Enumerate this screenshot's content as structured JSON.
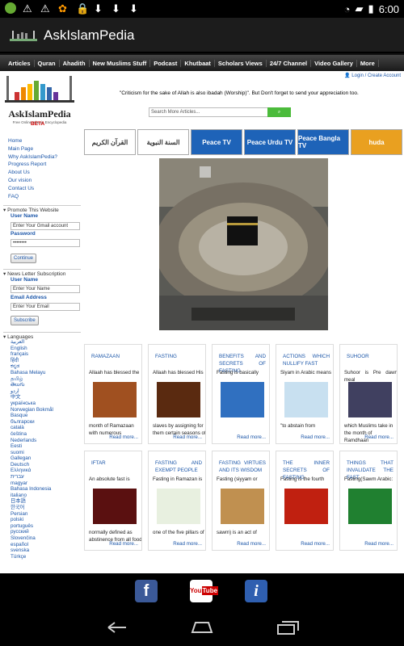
{
  "status": {
    "time": "6:00"
  },
  "app": {
    "title": "AskIslamPedia"
  },
  "nav": [
    "Articles",
    "Quran",
    "Ahadith",
    "New Muslims Stuff",
    "Podcast",
    "Khutbaat",
    "Scholars Views",
    "24/7 Channel",
    "Video Gallery",
    "More"
  ],
  "header": {
    "login": "Login",
    "separator": "/",
    "create": "Create Account",
    "quote": "\"Criticism for the sake of Allah is also ibadah (Worship)\". But Don't forget to send your appreciation too.",
    "search_placeholder": "Search More Articles...",
    "search_button": "Search"
  },
  "logo": {
    "name": "AskIslamPedia",
    "tagline": "Free Online Islamic Encyclopedia",
    "beta": "BETA"
  },
  "sidebar": {
    "links": [
      "Home",
      "Main Page",
      "Why AskIslamPedia?",
      "Progress Report",
      "About Us",
      "Our vision",
      "Contact Us",
      "FAQ"
    ],
    "promote_head": "Promote This Website",
    "promote_user_label": "User Name",
    "promote_user_value": "Enter Your Gmail account",
    "promote_pass_label": "Password",
    "promote_pass_value": "••••••••",
    "continue": "Continue",
    "newsletter_head": "News Letter Subscription",
    "news_user_label": "User Name",
    "news_user_value": "Enter Your Name",
    "news_email_label": "Email Address",
    "news_email_value": "Enter Your Email",
    "subscribe": "Subscribe",
    "languages_head": "Languages",
    "languages": [
      "العربية",
      "English",
      "français",
      "हिंदी",
      "ಕನ್ನಡ",
      "Bahasa Melayu",
      "தமிழ்",
      "తెలుగు",
      "اردو",
      "中文",
      "українська",
      "Norwegian Bokmål",
      "Basque",
      "български",
      "català",
      "čeština",
      "Nederlands",
      "Eesti",
      "suomi",
      "Gallegan",
      "Deutsch",
      "Ελληνικά",
      "עברית",
      "magyar",
      "Bahasa Indonesia",
      "italiano",
      "日本語",
      "한국어",
      "Persian",
      "polski",
      "português",
      "русский",
      "Slovenčina",
      "español",
      "svenska",
      "Türkçe"
    ]
  },
  "partner_logos": [
    "القرآن الكريم",
    "السنة النبوية",
    "Peace TV",
    "Peace Urdu TV",
    "Peace Bangla TV",
    "huda"
  ],
  "articles": [
    {
      "title": "RAMAZAAN",
      "snippet": "Allaah has blessed the",
      "snippet2": "month of Ramazaan with numerous",
      "more": "Read more..."
    },
    {
      "title": "FASTING",
      "snippet": "Allaah has blessed His",
      "snippet2": "slaves by assigning for them certain seasons of",
      "more": "Read more..."
    },
    {
      "title": "BENEFITS AND SECRETS OF FASTING",
      "snippet": "Fasting is basically",
      "snippet2": "",
      "more": "Read more..."
    },
    {
      "title": "ACTIONS WHICH NULLIFY FAST",
      "snippet": "Siyam in Arabic means",
      "snippet2": "\"to abstain from",
      "more": "Read more..."
    },
    {
      "title": "SUHOOR",
      "snippet": "Suhoor is Pre dawn meal",
      "snippet2": "which Muslims take in the month of Ramdhaan",
      "more": "Read more..."
    },
    {
      "title": "IFTAR",
      "snippet": "An absolute fast is",
      "snippet2": "normally defined as abstinence from all food",
      "more": "Read more..."
    },
    {
      "title": "FASTING AND EXEMPT PEOPLE",
      "snippet": "Fasting in Ramazan is",
      "snippet2": "one of the five pillars of",
      "more": "Read more..."
    },
    {
      "title": "FASTING VIRTUES AND ITS WISDOM",
      "snippet": "Fasting (siyyam or",
      "snippet2": "sawm) is an act of",
      "more": "Read more..."
    },
    {
      "title": "THE INNER SECRETS OF FASTING",
      "snippet": "Fasting is the fourth",
      "snippet2": "",
      "more": "Read more..."
    },
    {
      "title": "THINGS THAT INVALIDATE THE FAST",
      "snippet": "Fasting(Sawm Arabic:",
      "snippet2": "",
      "more": "Read more..."
    }
  ],
  "social": [
    "facebook",
    "YouTube",
    "info"
  ]
}
